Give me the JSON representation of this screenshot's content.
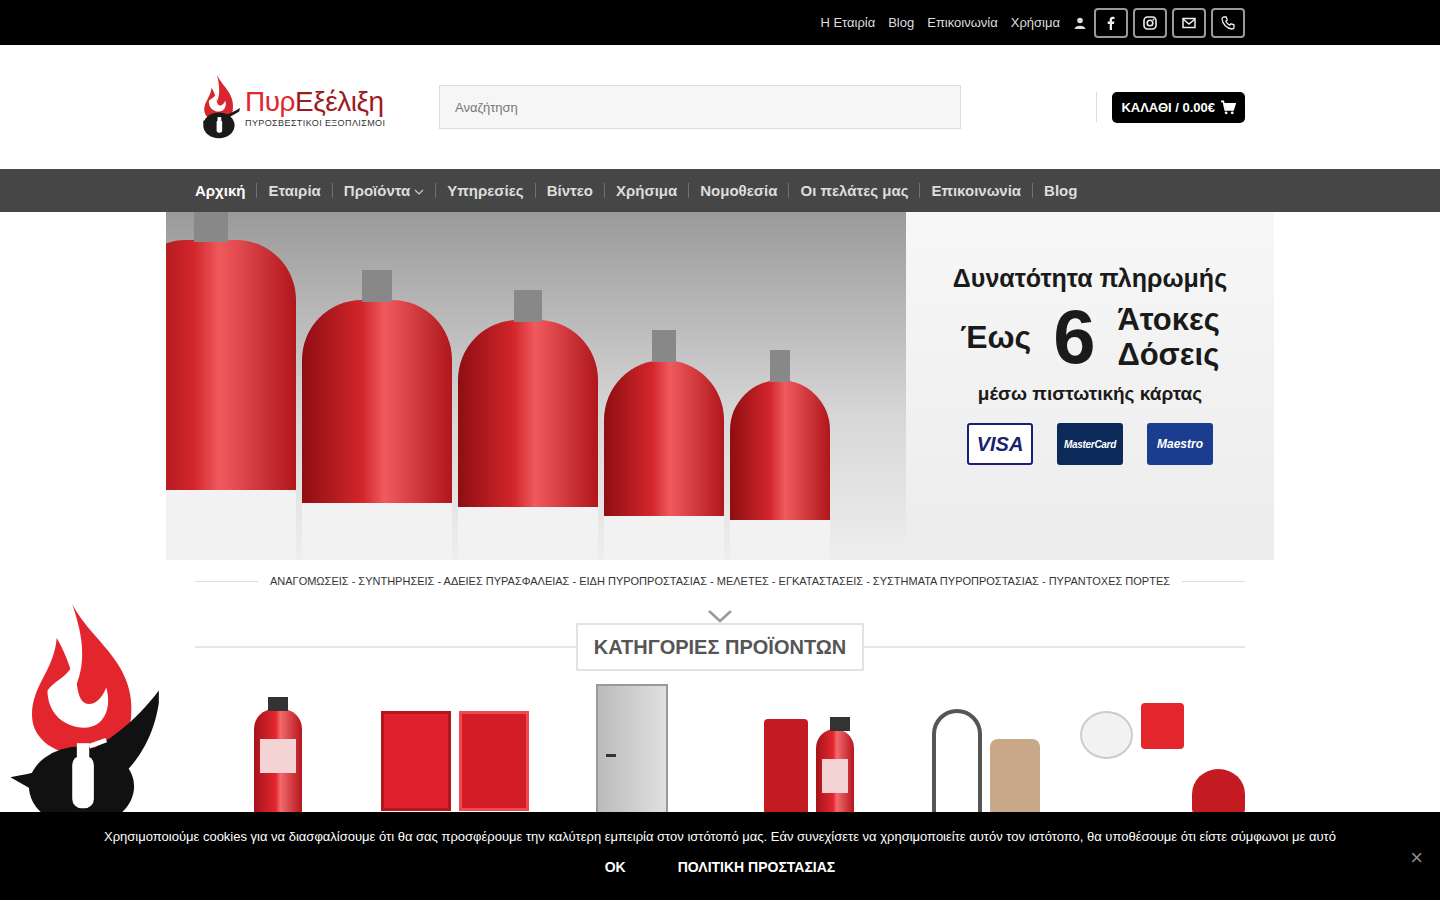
{
  "top_bar": {
    "links": [
      "Η Εταιρία",
      "Blog",
      "Επικοινωνία",
      "Χρήσιμα"
    ]
  },
  "header": {
    "logo": {
      "part1": "Πυρ",
      "part2": "Εξέλιξη",
      "subtitle": "ΠΥΡΟΣΒΕΣΤΙΚΟΙ ΕΞΟΠΛΙΣΜΟΙ"
    },
    "search": {
      "placeholder": "Αναζήτηση"
    },
    "cart": {
      "label": "ΚΑΛΑΘΙ / 0.00€"
    }
  },
  "nav": {
    "items": [
      {
        "label": "Αρχική",
        "selected": true,
        "dropdown": false
      },
      {
        "label": "Εταιρία",
        "selected": false,
        "dropdown": false
      },
      {
        "label": "Προϊόντα",
        "selected": false,
        "dropdown": true
      },
      {
        "label": "Υπηρεσίες",
        "selected": false,
        "dropdown": false
      },
      {
        "label": "Βίντεο",
        "selected": false,
        "dropdown": false
      },
      {
        "label": "Χρήσιμα",
        "selected": false,
        "dropdown": false
      },
      {
        "label": "Νομοθεσία",
        "selected": false,
        "dropdown": false
      },
      {
        "label": "Οι πελάτες μας",
        "selected": false,
        "dropdown": false
      },
      {
        "label": "Επικοινωνία",
        "selected": false,
        "dropdown": false
      },
      {
        "label": "Blog",
        "selected": false,
        "dropdown": false
      }
    ]
  },
  "banner": {
    "line1": "Δυνατότητα πληρωμής",
    "prefix": "Έως",
    "number": "6",
    "word1": "Άτοκες",
    "word2": "Δόσεις",
    "line3": "μέσω πιστωτικής κάρτας",
    "cards": [
      "VISA",
      "MasterCard",
      "Maestro"
    ]
  },
  "tagline": "ΑΝΑΓΟΜΩΣΕΙΣ - ΣΥΝΤΗΡΗΣΕΙΣ - ΑΔΕΙΕΣ ΠΥΡΑΣΦΑΛΕΙΑΣ - ΕΙΔΗ ΠΥΡΟΠΡΟΣΤΑΣΙΑΣ - ΜΕΛΕΤΕΣ - ΕΓΚΑΤΑΣΤΑΣΕΙΣ - ΣΥΣΤΗΜΑΤΑ ΠΥΡΟΠΡΟΣΤΑΣΙΑΣ - ΠΥΡΑΝΤΟΧΕΣ ΠΟΡΤΕΣ",
  "section": {
    "title": "ΚΑΤΗΓΟΡΙΕΣ ΠΡΟΪΟΝΤΩΝ"
  },
  "categories": [
    {
      "kind": "extinguisher"
    },
    {
      "kind": "cabinet"
    },
    {
      "kind": "door"
    },
    {
      "kind": "kit"
    },
    {
      "kind": "breathing"
    },
    {
      "kind": "alarm"
    }
  ],
  "cookie": {
    "text": "Χρησιμοποιούμε cookies για να διασφαλίσουμε ότι θα σας προσφέρουμε την καλύτερη εμπειρία στον ιστότοπό μας. Εάν συνεχίσετε να χρησιμοποιείτε αυτόν τον ιστότοπο, θα υποθέσουμε ότι είστε σύμφωνοι με αυτό",
    "buttons": [
      "OK",
      "ΠΟΛΙΤΙΚΗ ΠΡΟΣΤΑΣΙΑΣ"
    ],
    "close": "×"
  }
}
